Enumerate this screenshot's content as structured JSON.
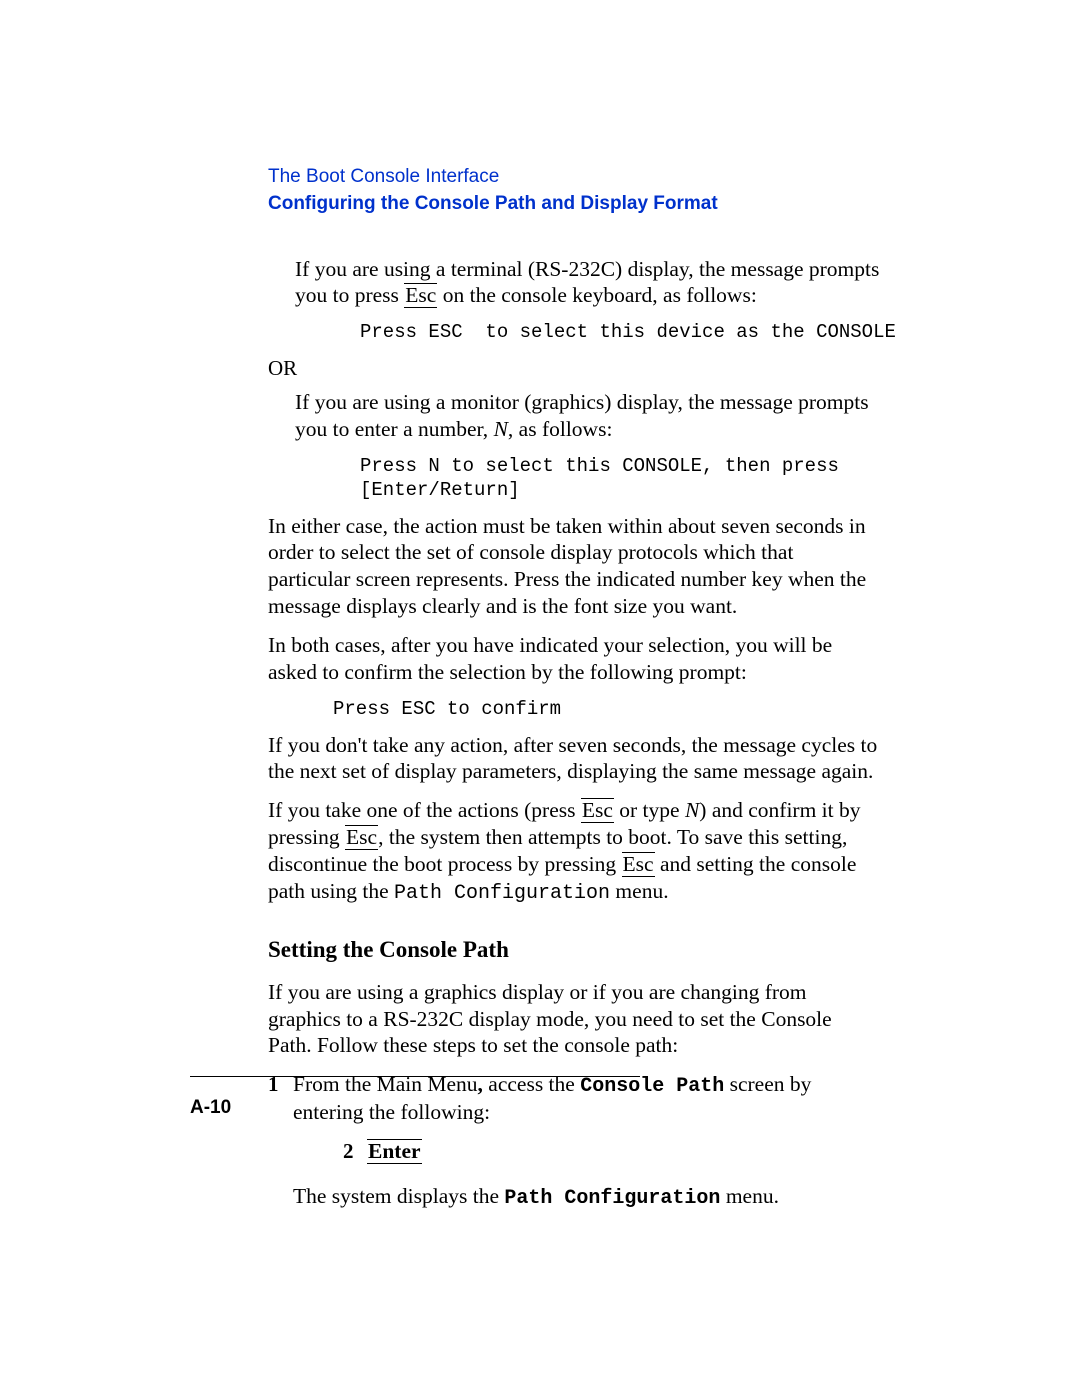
{
  "header": {
    "section": "The Boot Console Interface",
    "subsection": "Configuring the Console Path and Display Format"
  },
  "body": {
    "p1a": "If you are using a terminal (RS-232C) display, the message prompts you to press ",
    "esc": "Esc",
    "p1b": " on the console keyboard, as follows:",
    "code1": "Press ESC  to select this device as the CONSOLE",
    "or": "OR",
    "p2a": "If you are using a monitor (graphics) display, the message prompts you to enter a number, ",
    "p2N": "N",
    "p2b": ", as follows:",
    "code2": "Press N to select this CONSOLE, then press\n[Enter/Return]",
    "p3": "In either case, the action must be taken within about seven seconds in order to select the set of console display protocols which that particular screen represents. Press the indicated number key when the message displays clearly and is the font size you want.",
    "p4": "In both cases, after you have indicated your selection, you will be asked to confirm the selection by the following prompt:",
    "code3": "Press ESC to confirm",
    "p5": " If you don't take any action, after seven seconds, the message cycles to the next set of display parameters, displaying the same message again.",
    "p6a": "If you take one of the actions (press ",
    "p6b": " or type ",
    "p6N": "N",
    "p6c": ") and confirm it by pressing ",
    "p6d": ", the system then attempts to boot. To save this setting, discontinue the boot process by pressing ",
    "p6e": "  and setting the console path using the ",
    "p6f": "Path Configuration",
    "p6g": " menu.",
    "subhead": "Setting the Console Path",
    "p7": "If you are using a graphics display or if you are changing from graphics to a RS-232C display mode, you need to set the Console Path. Follow these steps to set the console path:",
    "step1num": "1",
    "step1a": "From the Main Menu",
    "step1comma": ",",
    "step1b": " access the ",
    "step1c": "Console Path",
    "step1d": " screen by entering the following:",
    "step2num": "2",
    "enter": "Enter",
    "p8a": "The system displays the ",
    "p8b": "Path Configuration",
    "p8c": " menu."
  },
  "footer": {
    "pagenum": "A-10"
  }
}
